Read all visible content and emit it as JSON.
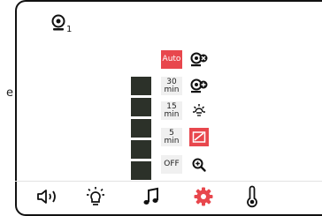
{
  "edge_label": "e",
  "camera": {
    "icon": "webcam-icon",
    "number": "1"
  },
  "options": [
    {
      "id": "auto",
      "line1": "Auto",
      "line2": "",
      "selected": true
    },
    {
      "id": "30min",
      "line1": "30",
      "line2": "min",
      "selected": false
    },
    {
      "id": "15min",
      "line1": "15",
      "line2": "min",
      "selected": false
    },
    {
      "id": "5min",
      "line1": "5",
      "line2": "min",
      "selected": false
    },
    {
      "id": "off",
      "line1": "OFF",
      "line2": "",
      "selected": false
    }
  ],
  "side_icons": [
    {
      "icon": "camera-remove-icon",
      "active": false
    },
    {
      "icon": "camera-add-icon",
      "active": false
    },
    {
      "icon": "brightness-icon",
      "active": false
    },
    {
      "icon": "picture-edit-icon",
      "active": true
    },
    {
      "icon": "zoom-in-icon",
      "active": false
    }
  ],
  "bottom_tabs": [
    {
      "icon": "speaker-icon",
      "active": false
    },
    {
      "icon": "bulb-icon",
      "active": false
    },
    {
      "icon": "music-note-icon",
      "active": false
    },
    {
      "icon": "gear-icon",
      "active": true
    },
    {
      "icon": "thermometer-icon",
      "active": false
    }
  ],
  "colors": {
    "accent": "#e8474d",
    "dark_box": "#2c3129",
    "icon": "#111111",
    "option_bg": "#f0f0f0"
  }
}
